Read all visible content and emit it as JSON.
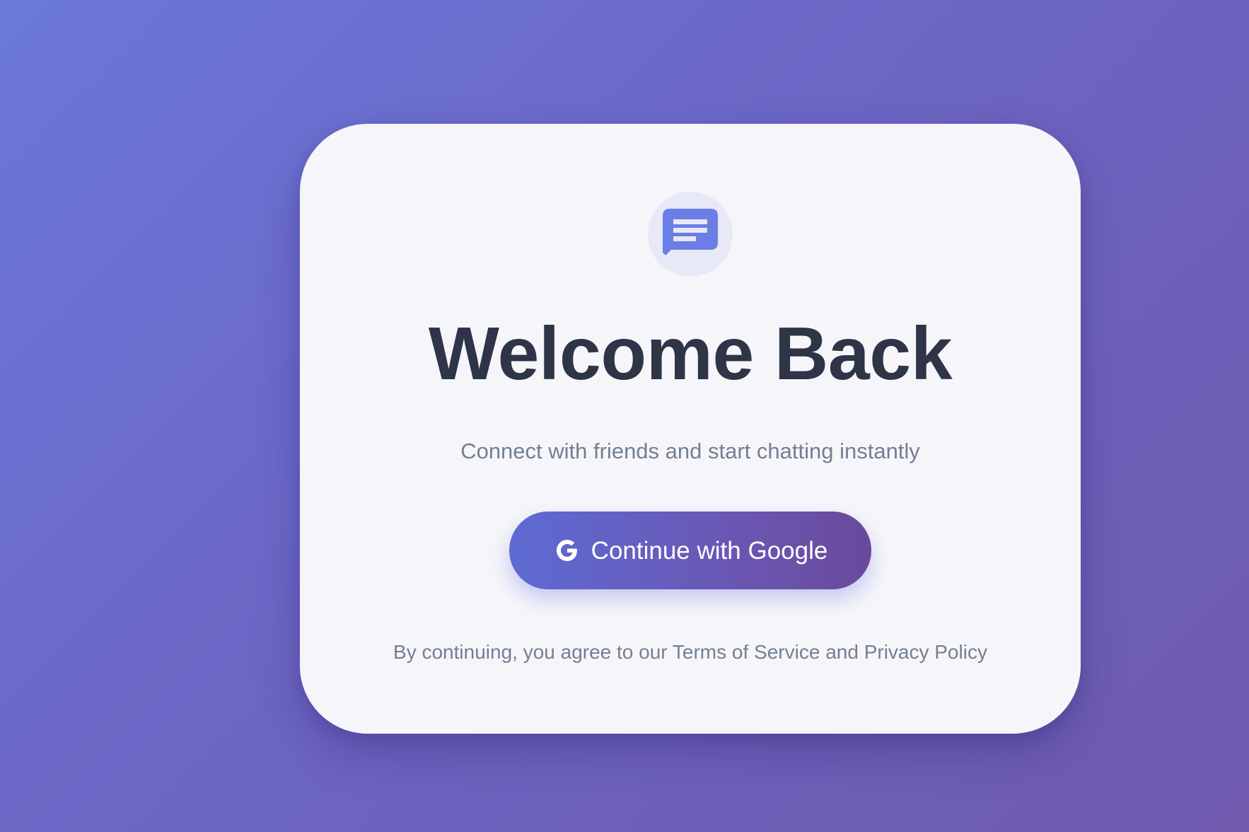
{
  "login": {
    "logo_icon": "chat-bubble-icon",
    "title": "Welcome Back",
    "subtitle": "Connect with friends and start chatting instantly",
    "google_button": {
      "icon": "google-g-icon",
      "label": "Continue with Google"
    },
    "legal": {
      "prefix": "By continuing, you agree to our",
      "terms_link": "Terms of Service",
      "conjunction": "and",
      "privacy_link": "Privacy Policy"
    }
  },
  "colors": {
    "background_start": "#6b78da",
    "background_end": "#6f5aae",
    "card_background": "#f6f6fa",
    "accent": "#6b7ee6",
    "title_text": "#2d3546",
    "muted_text": "#737f92",
    "button_start": "#5d6bd3",
    "button_end": "#694a9c"
  }
}
